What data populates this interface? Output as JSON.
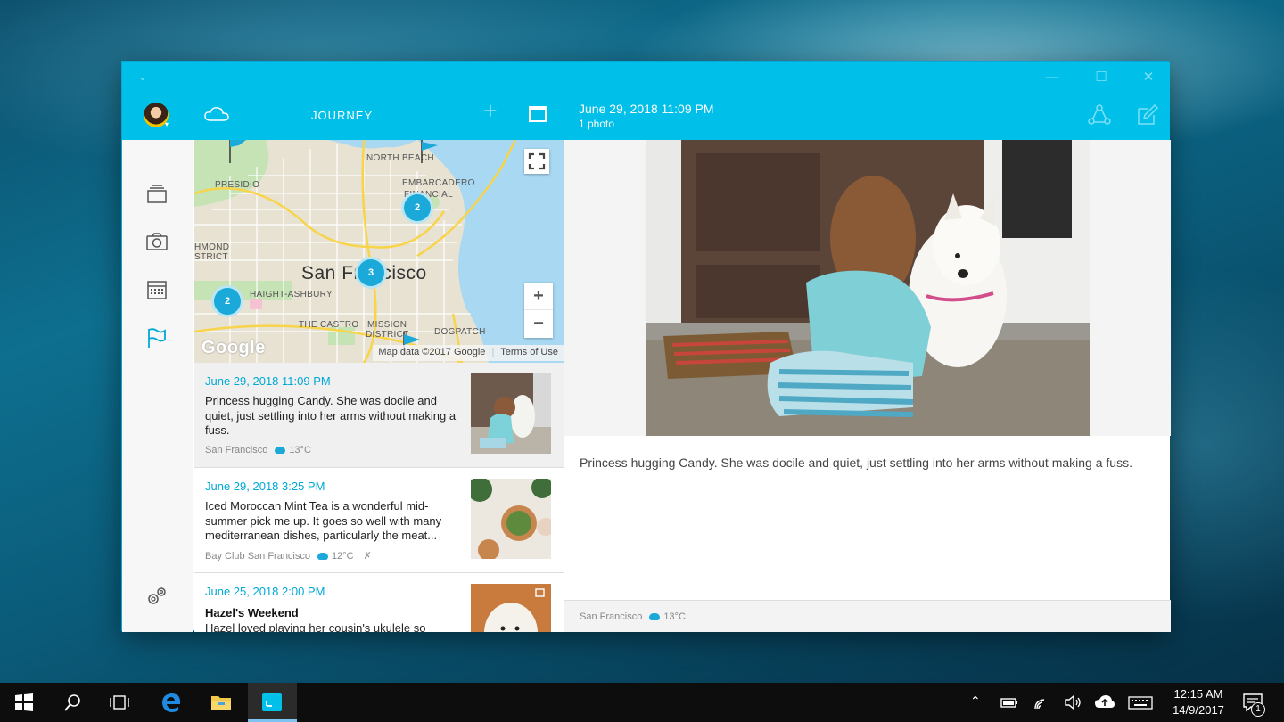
{
  "app": {
    "title": "JOURNEY"
  },
  "header": {
    "entry_date": "June 29, 2018 11:09 PM",
    "entry_count": "1 photo"
  },
  "map": {
    "labels": {
      "north_beach": "NORTH BEACH",
      "embarcadero": "EMBARCADERO",
      "financial": "FINANCIAL",
      "presidio": "PRESIDIO",
      "richmond": "HMOND",
      "district": "STRICT",
      "haight": "HAIGHT-ASHBURY",
      "castro": "THE CASTRO",
      "mission": "MISSION",
      "mission2": "DISTRICT",
      "dogpatch": "DOGPATCH"
    },
    "city": "San Francisco",
    "clusters": [
      "2",
      "3",
      "2"
    ],
    "zoom_in": "+",
    "zoom_out": "−",
    "logo": "Google",
    "attribution": "Map data ©2017 Google",
    "terms": "Terms of Use"
  },
  "entries": [
    {
      "date": "June 29, 2018 11:09 PM",
      "text": "Princess hugging Candy. She was docile and quiet, just settling into her arms without making a fuss.",
      "location": "San Francisco",
      "temp": "13°C"
    },
    {
      "date": "June 29, 2018 3:25 PM",
      "text": "Iced Moroccan Mint Tea is a wonderful mid-summer pick me up. It goes so well with many mediterranean dishes, particularly the meat...",
      "location": "Bay Club San Francisco",
      "temp": "12°C"
    },
    {
      "date": "June 25, 2018 2:00 PM",
      "title": "Hazel's Weekend",
      "text": "Hazel loved playing her cousin's ukulele so"
    }
  ],
  "detail": {
    "caption": "Princess hugging Candy. She was docile and quiet, just settling into her arms without making a fuss.",
    "location": "San Francisco",
    "temp": "13°C"
  },
  "taskbar": {
    "time": "12:15 AM",
    "date": "14/9/2017",
    "notifications": "1"
  },
  "colors": {
    "accent": "#00bfe8",
    "link": "#00a9d6",
    "cluster": "#1aa9d8"
  }
}
